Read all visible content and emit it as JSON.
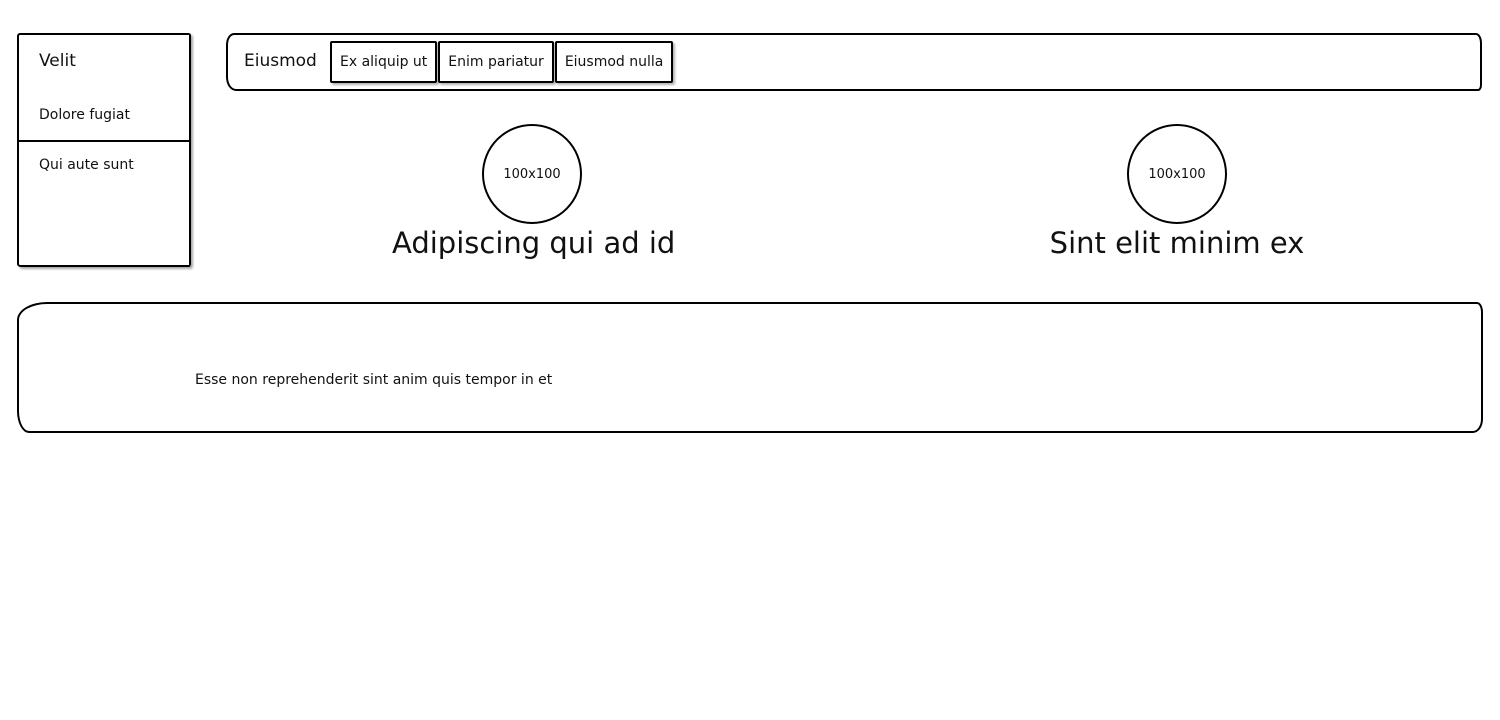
{
  "sidebar": {
    "title": "Velit",
    "items": [
      {
        "label": "Dolore fugiat"
      },
      {
        "label": "Qui aute sunt"
      }
    ]
  },
  "topbar": {
    "brand": "Eiusmod",
    "tabs": [
      {
        "label": "Ex aliquip ut"
      },
      {
        "label": "Enim pariatur"
      },
      {
        "label": "Eiusmod nulla"
      }
    ]
  },
  "cards": [
    {
      "image_placeholder": "100x100",
      "caption": "Adipiscing qui ad id"
    },
    {
      "image_placeholder": "100x100",
      "caption": "Sint elit minim ex"
    }
  ],
  "footer": {
    "text": "Esse non reprehenderit sint anim quis tempor in et"
  }
}
